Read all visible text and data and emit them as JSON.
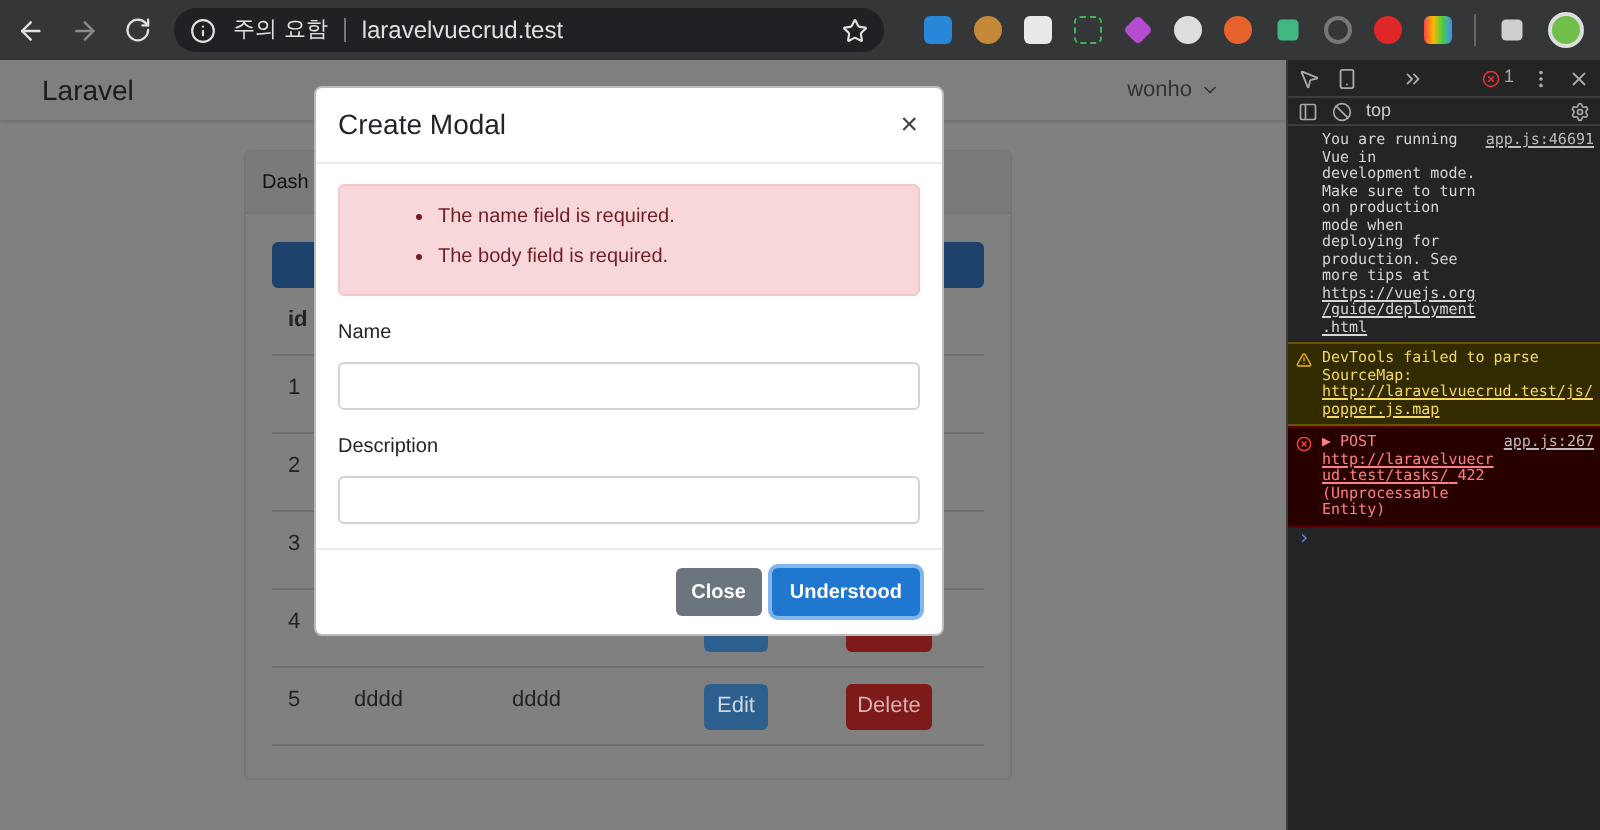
{
  "browser": {
    "security_label": "주의 요함",
    "url": "laravelvuecrud.test"
  },
  "navbar": {
    "brand": "Laravel",
    "user": "wonho"
  },
  "card": {
    "header": "Dash",
    "table": {
      "columns": [
        "id"
      ],
      "rows": [
        {
          "id": "1",
          "actions": false
        },
        {
          "id": "2",
          "actions": false
        },
        {
          "id": "3",
          "actions": false
        },
        {
          "id": "4",
          "actions": true
        },
        {
          "id": "5",
          "name": "dddd",
          "body": "dddd",
          "actions": true,
          "edit": "Edit",
          "delete": "Delete"
        }
      ]
    }
  },
  "modal": {
    "title": "Create Modal",
    "close": "×",
    "errors": [
      "The name field is required.",
      "The body field is required."
    ],
    "fields": [
      {
        "label": "Name"
      },
      {
        "label": "Description"
      }
    ],
    "buttons": [
      {
        "label": "Close",
        "kind": "secondary"
      },
      {
        "label": "Understood",
        "kind": "primary"
      }
    ]
  },
  "devtools": {
    "error_count": "1",
    "context": "top",
    "prompt": "›",
    "messages": [
      {
        "kind": "info",
        "source": "app.js:46691",
        "parts": [
          {
            "kind": "text",
            "text": "You are running Vue in development mode. Make sure to turn on production mode when deploying for production. See more tips at"
          },
          {
            "kind": "link",
            "text": "https://vuejs.org/guide/deployment.html"
          }
        ]
      },
      {
        "kind": "warning",
        "parts": [
          {
            "kind": "text",
            "text": "DevTools failed to parse SourceMap:"
          },
          {
            "kind": "link",
            "text": "http://laravelvuecrud.test/js/popper.js.map"
          }
        ]
      },
      {
        "kind": "error",
        "source": "app.js:267",
        "parts": [
          {
            "kind": "text",
            "text": "▶ POST"
          },
          {
            "kind": "link",
            "text": "http://laravelvuecrud.test/tasks/"
          },
          {
            "kind": "text",
            "text": "422 (Unprocessable Entity)"
          }
        ]
      }
    ]
  }
}
